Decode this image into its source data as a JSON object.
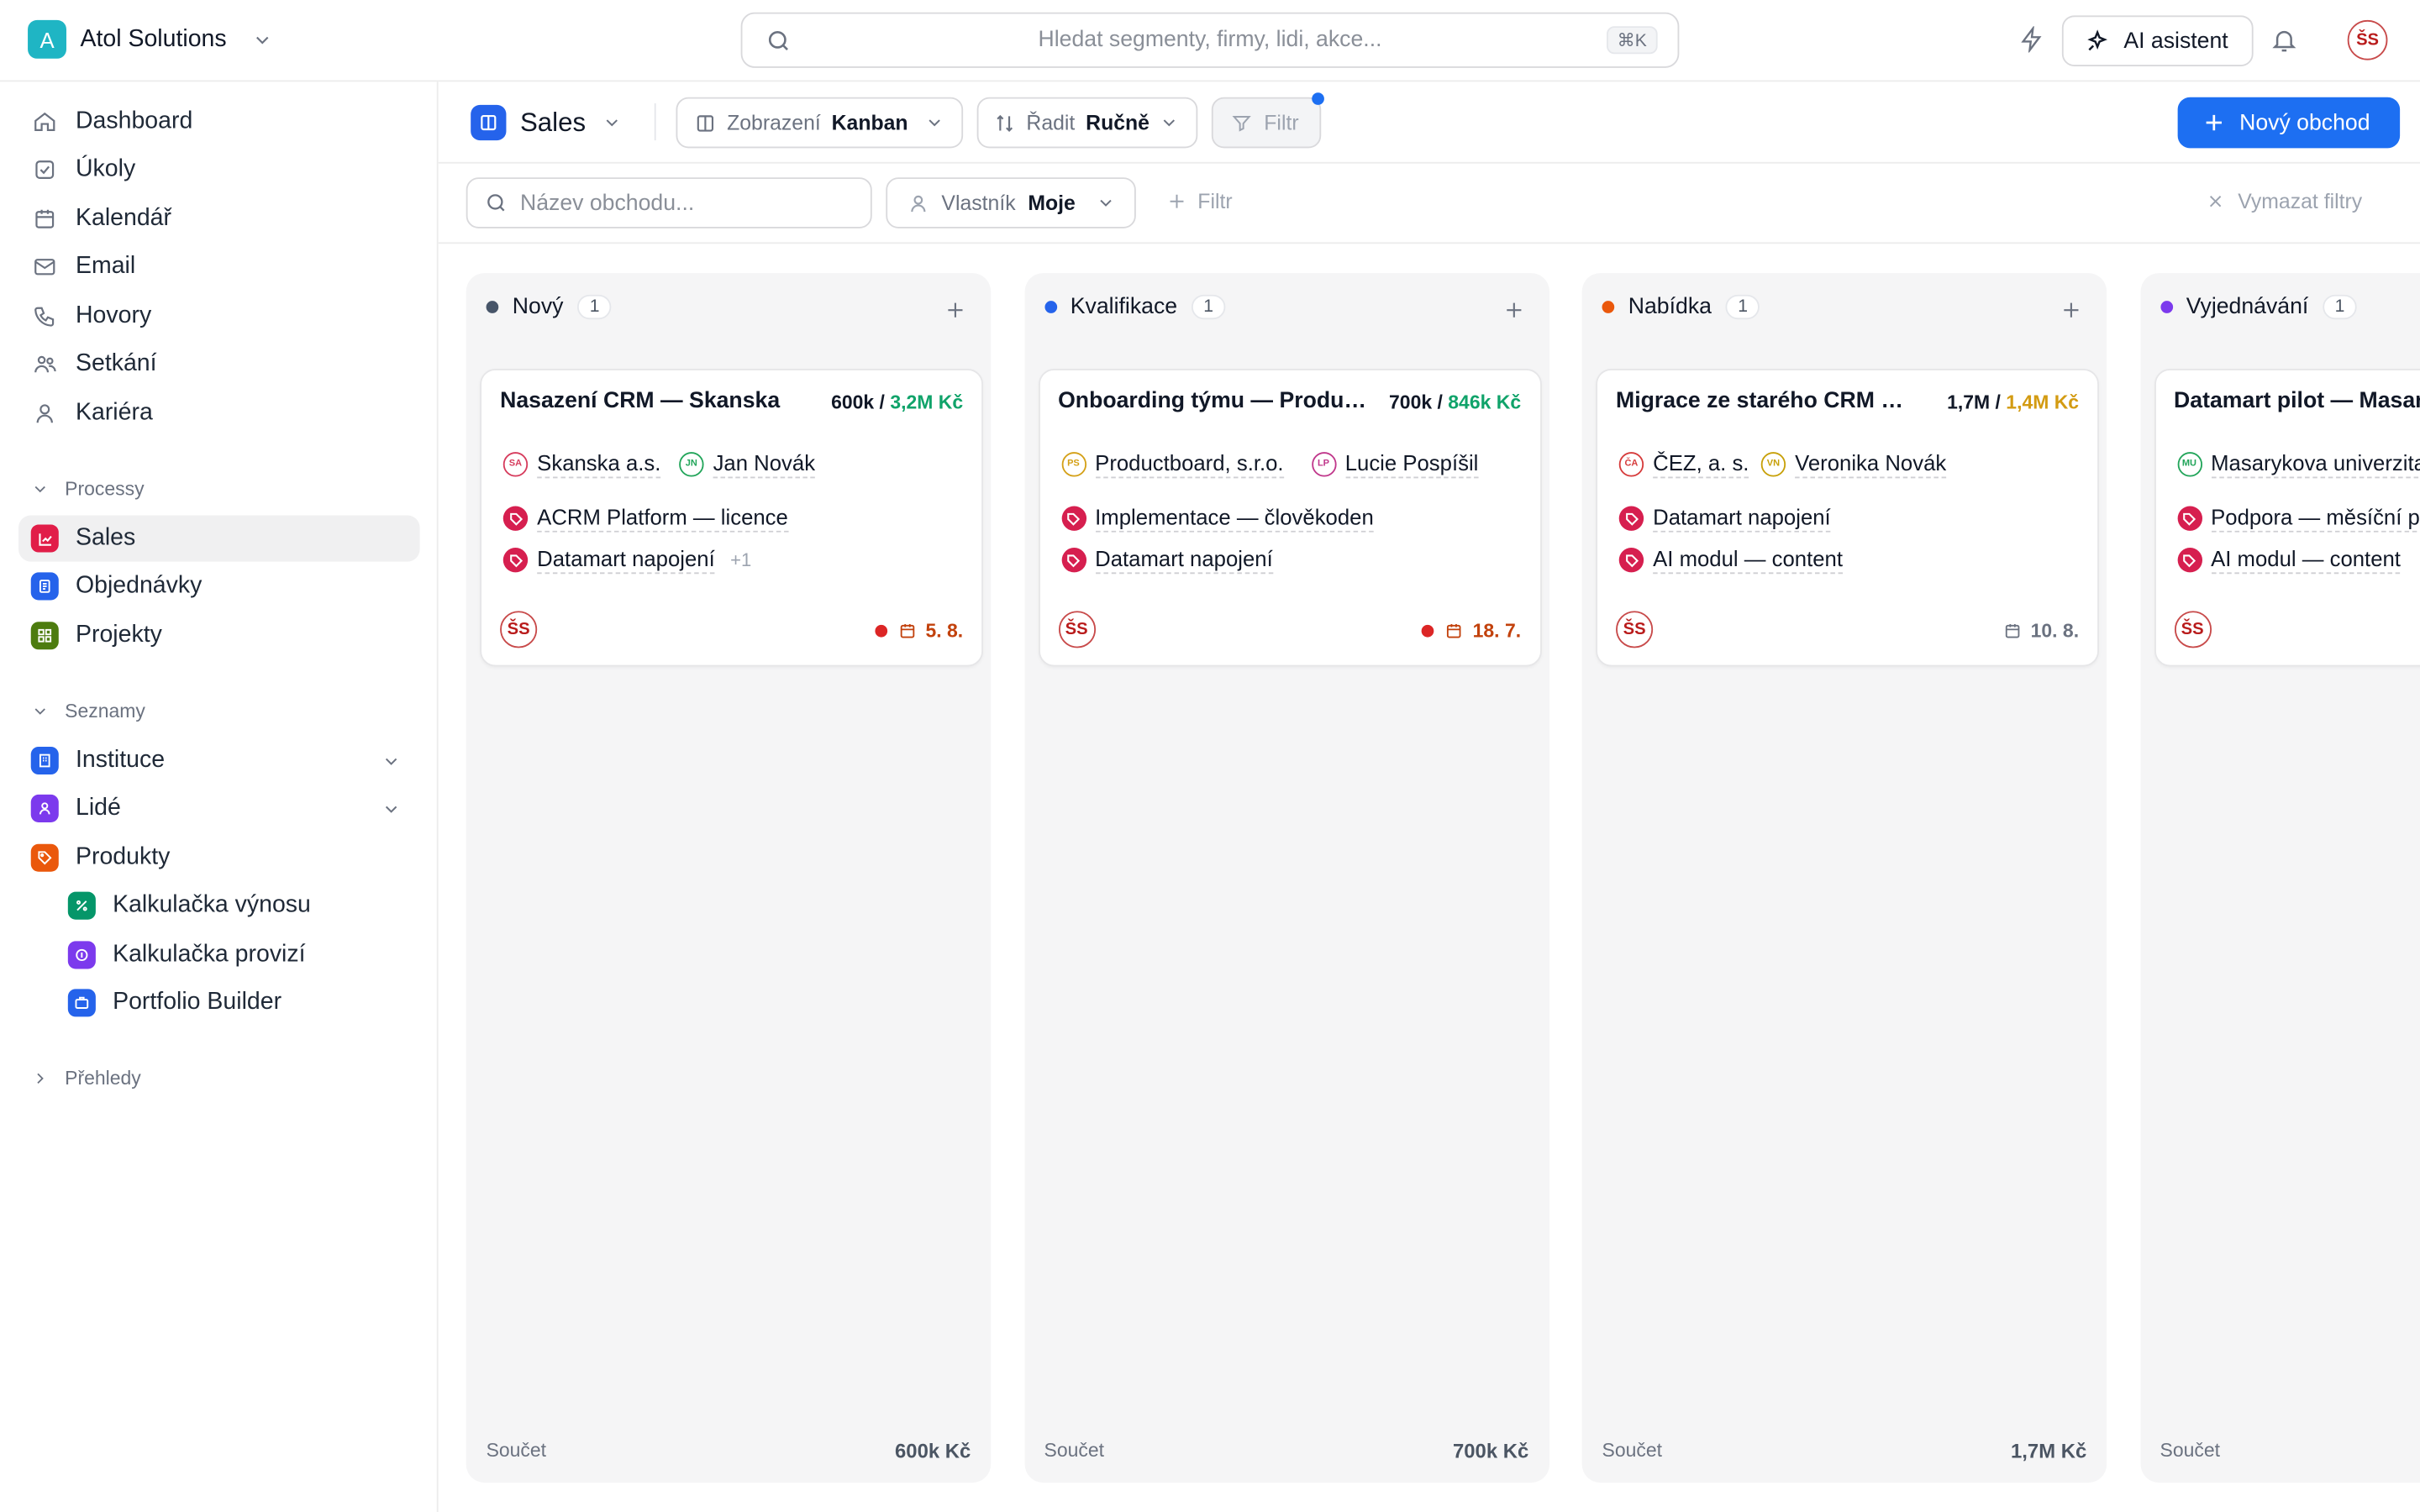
{
  "workspace": {
    "initial": "A",
    "name": "Atol Solutions"
  },
  "search": {
    "placeholder": "Hledat segmenty, firmy, lidi, akce...",
    "shortcut": "⌘K"
  },
  "topbar": {
    "ai_label": "AI asistent",
    "user_initials": "ŠS"
  },
  "nav": {
    "items": [
      "Dashboard",
      "Úkoly",
      "Kalendář",
      "Email",
      "Hovory",
      "Setkání",
      "Kariéra"
    ]
  },
  "processes": {
    "title": "Processy",
    "items": [
      "Sales",
      "Objednávky",
      "Projekty"
    ]
  },
  "lists": {
    "title": "Seznamy",
    "items": [
      "Instituce",
      "Lidé",
      "Produkty"
    ],
    "sub": [
      "Kalkulačka výnosu",
      "Kalkulačka provizí",
      "Portfolio Builder"
    ]
  },
  "reports": {
    "title": "Přehledy"
  },
  "toolbar": {
    "pipeline": "Sales",
    "view_label": "Zobrazení",
    "view_value": "Kanban",
    "sort_label": "Řadit",
    "sort_value": "Ručně",
    "filter_label": "Filtr",
    "new_deal": "Nový obchod"
  },
  "filters": {
    "name_placeholder": "Název obchodu...",
    "owner_label": "Vlastník",
    "owner_value": "Moje",
    "add_filter": "Filtr",
    "clear": "Vymazat filtry"
  },
  "colors": {
    "accent": "#1d6ff2",
    "brand": "#1fb5c4"
  },
  "columns": [
    {
      "name": "Nový",
      "count": "1",
      "color": "#475569",
      "sum_label": "Součet",
      "sum": "600k Kč",
      "card": {
        "title": "Nasazení CRM — Skanska",
        "amount": "600k /",
        "amount2": "3,2M Kč",
        "amount2_color": "#10a36a",
        "company": "Skanska a.s.",
        "company_av": "SA",
        "company_color": "#d63b5c",
        "person": "Jan Novák",
        "person_av": "JN",
        "person_color": "#22a55a",
        "products": [
          "ACRM Platform — licence",
          "Datamart napojení"
        ],
        "more": "+1",
        "owner": "ŠS",
        "due": "5. 8.",
        "due_color": "#c2410c",
        "due_dot": true
      }
    },
    {
      "name": "Kvalifikace",
      "count": "1",
      "color": "#2563eb",
      "sum_label": "Součet",
      "sum": "700k Kč",
      "card": {
        "title": "Onboarding týmu — Productboard",
        "amount": "700k /",
        "amount2": "846k Kč",
        "amount2_color": "#10a36a",
        "company": "Productboard, s.r.o.",
        "company_av": "PS",
        "company_color": "#d4a017",
        "person": "Lucie Pospíšil",
        "person_av": "LP",
        "person_color": "#c0378b",
        "products": [
          "Implementace — člověkoden",
          "Datamart napojení"
        ],
        "more": "",
        "owner": "ŠS",
        "due": "18. 7.",
        "due_color": "#c2410c",
        "due_dot": true
      }
    },
    {
      "name": "Nabídka",
      "count": "1",
      "color": "#ea580c",
      "sum_label": "Součet",
      "sum": "1,7M Kč",
      "card": {
        "title": "Migrace ze starého CRM — ČEZ",
        "amount": "1,7M /",
        "amount2": "1,4M Kč",
        "amount2_color": "#d39b12",
        "company": "ČEZ, a. s.",
        "company_av": "ČA",
        "company_color": "#d63b3b",
        "person": "Veronika Novák",
        "person_av": "VN",
        "person_color": "#c7a008",
        "products": [
          "Datamart napojení",
          "AI modul — content"
        ],
        "more": "",
        "owner": "ŠS",
        "due": "10. 8.",
        "due_color": "#6b7280",
        "due_dot": false
      }
    },
    {
      "name": "Vyjednávání",
      "count": "1",
      "color": "#7c3aed",
      "sum_label": "Součet",
      "sum": "",
      "card": {
        "title": "Datamart pilot — Masarykova univerzita",
        "amount": "",
        "amount2": "",
        "amount2_color": "#10a36a",
        "company": "Masarykova univerzita",
        "company_av": "MU",
        "company_color": "#22a55a",
        "person": "",
        "person_av": "",
        "person_color": "#22a55a",
        "products": [
          "Podpora — měsíční paušál",
          "AI modul — content"
        ],
        "more": "",
        "owner": "ŠS",
        "due": "",
        "due_color": "#6b7280",
        "due_dot": false
      }
    }
  ]
}
